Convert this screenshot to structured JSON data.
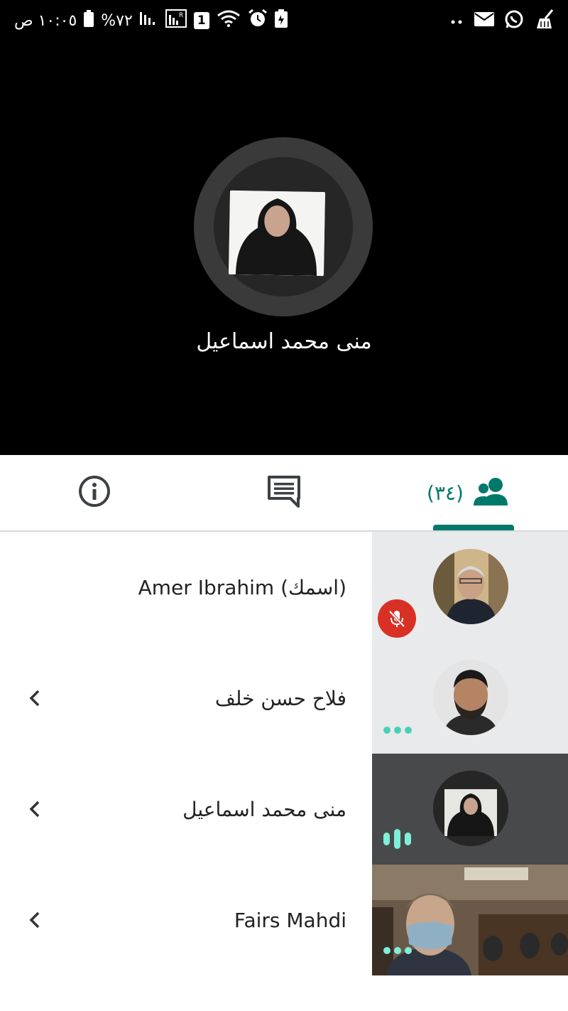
{
  "status_bar": {
    "time": "١٠:٠٥ ص",
    "battery": "%٧٢",
    "sim_badge": "1"
  },
  "stage": {
    "speaker_name": "منی محمد اسماعیل"
  },
  "tabs": {
    "participants_count": "(٣٤)"
  },
  "participants": [
    {
      "name": "Amer Ibrahim (اسمك)",
      "status": "muted"
    },
    {
      "name": "فلاح حسن خلف",
      "status": "dots"
    },
    {
      "name": "منی محمد اسماعیل",
      "status": "speaking"
    },
    {
      "name": "Fairs Mahdi",
      "status": "dots"
    }
  ],
  "colors": {
    "accent": "#00796b",
    "mute_red": "#d93025",
    "audio_teal": "#4ad0b8"
  }
}
